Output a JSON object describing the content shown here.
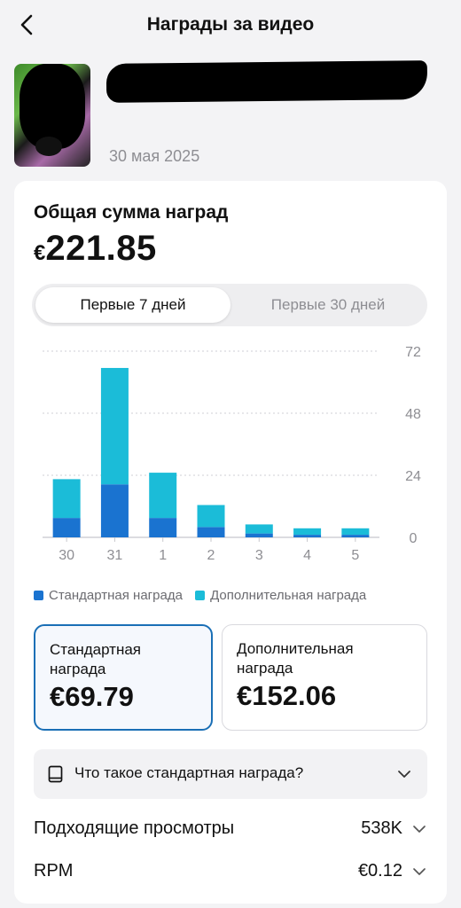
{
  "header": {
    "title": "Награды за видео"
  },
  "video": {
    "date": "30 мая 2025"
  },
  "summary": {
    "label": "Общая сумма наград",
    "currency": "€",
    "amount": "221.85"
  },
  "period_tabs": [
    {
      "label": "Первые 7 дней",
      "active": true
    },
    {
      "label": "Первые 30 дней",
      "active": false
    }
  ],
  "chart_data": {
    "type": "bar",
    "stacked": true,
    "categories": [
      "30",
      "31",
      "1",
      "2",
      "3",
      "4",
      "5"
    ],
    "series": [
      {
        "name": "Стандартная награда",
        "color": "#1a73d0",
        "values": [
          7.5,
          20.5,
          7.5,
          4,
          1.5,
          1,
          1
        ]
      },
      {
        "name": "Дополнительная награда",
        "color": "#1bbcd8",
        "values": [
          15,
          45,
          17.5,
          8.5,
          3.5,
          2.5,
          2.5
        ]
      }
    ],
    "y_ticks": [
      "0",
      "24",
      "48",
      "72"
    ],
    "ylim": [
      0,
      72
    ],
    "grid": true,
    "y_axis_side": "right"
  },
  "legend": [
    {
      "label": "Стандартная награда",
      "color": "#1a73d0"
    },
    {
      "label": "Дополнительная награда",
      "color": "#1bbcd8"
    }
  ],
  "reward_boxes": {
    "standard": {
      "label": "Стандартная награда",
      "value": "€69.79"
    },
    "additional": {
      "label": "Дополнительная награда",
      "value": "€152.06"
    }
  },
  "info": {
    "text": "Что такое стандартная награда?"
  },
  "metrics": {
    "views": {
      "label": "Подходящие просмотры",
      "value": "538K"
    },
    "rpm": {
      "label": "RPM",
      "value": "€0.12"
    }
  },
  "icons": {
    "back": "chevron-left-icon",
    "info_row": "book-icon",
    "expand": "chevron-down-icon"
  }
}
